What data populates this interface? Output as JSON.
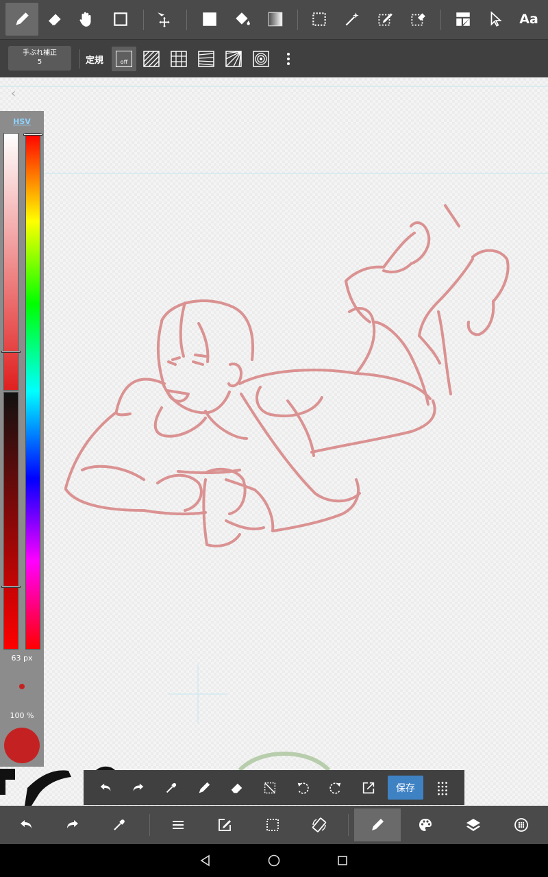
{
  "top_toolbar": {
    "tools": [
      "pen-icon",
      "eraser-icon",
      "hand-icon",
      "shape-icon",
      "move-icon",
      "fill-rect-icon",
      "bucket-icon",
      "gradient-icon",
      "select-icon",
      "magic-wand-icon",
      "select-pen-icon",
      "select-eraser-icon",
      "frame-icon",
      "operate-icon",
      "text-icon"
    ],
    "text_tool_label": "Aa"
  },
  "sub_toolbar": {
    "stabilizer_label": "手ぶれ補正",
    "stabilizer_value": "5",
    "ruler_label": "定規",
    "ruler_off_label": "off"
  },
  "color_panel": {
    "mode_label": "HSV",
    "brush_size": "63 px",
    "opacity": "100 %",
    "current_color": "#c42222"
  },
  "float_toolbar": {
    "save_label": "保存"
  },
  "colors": {
    "toolbar_bg": "#4a4a4a",
    "accent_blue": "#3f82c4",
    "sketch_line": "#d98a8a"
  }
}
